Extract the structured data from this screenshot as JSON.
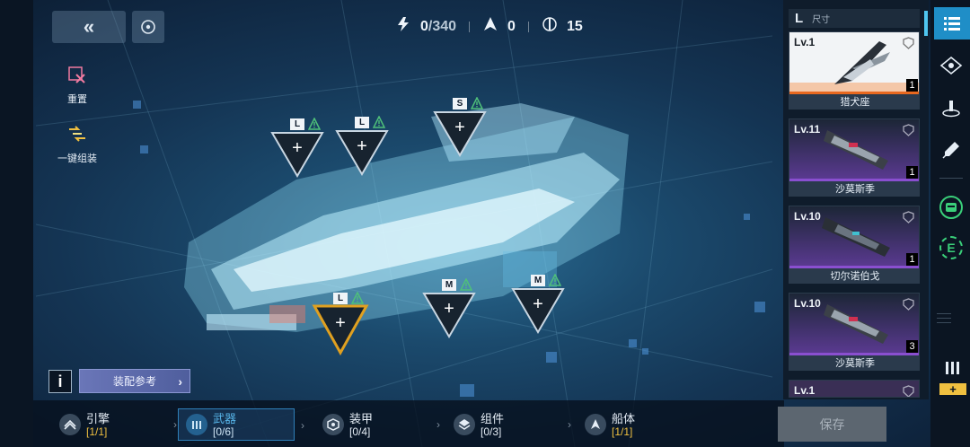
{
  "top": {
    "back_icon": "double-chevron-left-icon",
    "target_icon": "target-icon"
  },
  "tools": {
    "reset_label": "重置",
    "auto_equip_label": "一键组装"
  },
  "stats": {
    "power_value": "0",
    "power_max": "/340",
    "ships_value": "0",
    "slots_value": "15"
  },
  "slots": [
    {
      "size": "L",
      "symbol": "+"
    },
    {
      "size": "L",
      "symbol": "+"
    },
    {
      "size": "S",
      "symbol": "+"
    },
    {
      "size": "L",
      "symbol": "+"
    },
    {
      "size": "M",
      "symbol": "+"
    },
    {
      "size": "M",
      "symbol": "+"
    }
  ],
  "reference": {
    "info_label": "i",
    "button_label": "装配参考",
    "arrow": "›"
  },
  "bottom_tabs": [
    {
      "label": "引擎",
      "count": "[1/1]",
      "count_color": "#f0c040",
      "icon": "engine-icon"
    },
    {
      "label": "武器",
      "count": "[0/6]",
      "count_color": "#cfe6f6",
      "icon": "weapon-icon"
    },
    {
      "label": "装甲",
      "count": "[0/4]",
      "count_color": "#e6eef6",
      "icon": "armor-icon"
    },
    {
      "label": "组件",
      "count": "[0/3]",
      "count_color": "#e6eef6",
      "icon": "component-icon"
    },
    {
      "label": "船体",
      "count": "[1/1]",
      "count_color": "#f0c040",
      "icon": "hull-icon"
    }
  ],
  "save_label": "保存",
  "panel": {
    "size_letter": "L",
    "size_label": "尺寸",
    "cards": [
      {
        "level": "Lv.1",
        "name": "猎犬座",
        "count": "1",
        "rarity_color": "#e8681f"
      },
      {
        "level": "Lv.11",
        "name": "沙莫斯季",
        "count": "1",
        "rarity_color": "#8a4fd0"
      },
      {
        "level": "Lv.10",
        "name": "切尔诺伯戈",
        "count": "1",
        "rarity_color": "#8a4fd0"
      },
      {
        "level": "Lv.10",
        "name": "沙莫斯季",
        "count": "3",
        "rarity_color": "#8a4fd0"
      },
      {
        "level": "Lv.1",
        "name": "",
        "count": "",
        "rarity_color": "#8a4fd0"
      }
    ]
  },
  "rail": {
    "e_label": "E",
    "add_symbol": "+"
  },
  "colors": {
    "accent_blue": "#1f8ec7",
    "selected_slot": "#e0a020",
    "warning_green": "#4fc07a"
  }
}
